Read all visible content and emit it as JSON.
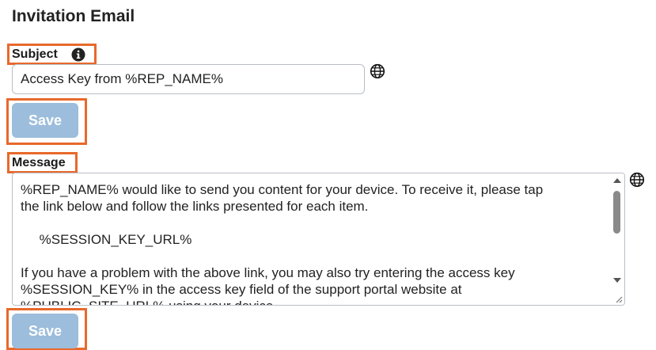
{
  "section_title": "Invitation Email",
  "subject": {
    "label": "Subject",
    "value": "Access Key from %REP_NAME%",
    "info_icon": "info-icon",
    "globe_icon": "globe-icon"
  },
  "save_button_label": "Save",
  "message": {
    "label": "Message",
    "text": "%REP_NAME% would like to send you content for your device. To receive it, please tap\nthe link below and follow the links presented for each item.\n\n     %SESSION_KEY_URL%\n\nIf you have a problem with the above link, you may also try entering the access key\n%SESSION_KEY% in the access key field of the support portal website at\n%PUBLIC_SITE_URL% using your device.",
    "globe_icon": "globe-icon"
  },
  "colors": {
    "highlight": "#e8692c",
    "button_disabled": "#9cbddb"
  }
}
